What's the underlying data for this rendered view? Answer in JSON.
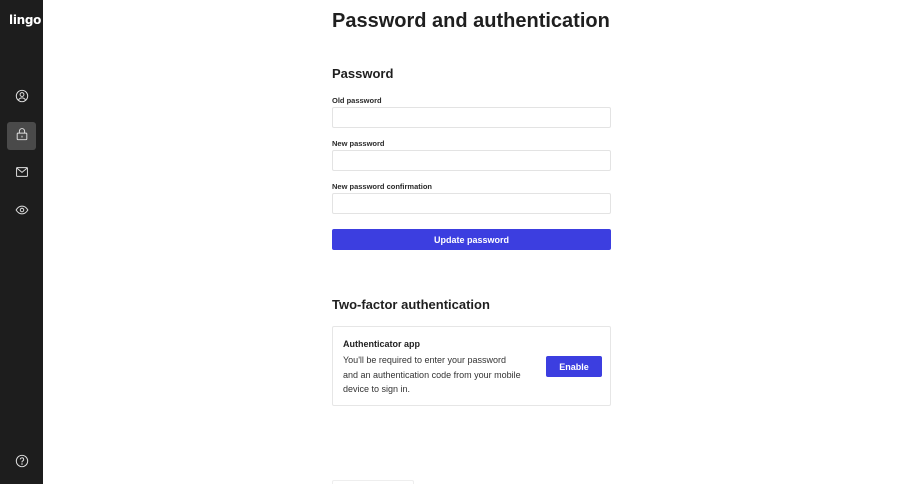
{
  "app": {
    "logo_text": "lingo"
  },
  "sidebar": {
    "items": [
      {
        "icon": "user-circle-icon",
        "active": false
      },
      {
        "icon": "lock-icon",
        "active": true
      },
      {
        "icon": "mail-icon",
        "active": false
      },
      {
        "icon": "eye-icon",
        "active": false
      }
    ],
    "help_icon": "help-circle-icon"
  },
  "page": {
    "title": "Password and authentication"
  },
  "password": {
    "section_title": "Password",
    "old_label": "Old password",
    "old_value": "",
    "new_label": "New password",
    "new_value": "",
    "confirm_label": "New password confirmation",
    "confirm_value": "",
    "submit_label": "Update password"
  },
  "two_factor": {
    "section_title": "Two-factor authentication",
    "app_title": "Authenticator app",
    "app_description": "You'll be required to enter your password and an authentication code from your mobile device to sign in.",
    "enable_label": "Enable"
  },
  "colors": {
    "sidebar_bg": "#1d1d1d",
    "sidebar_active": "#4a4a4a",
    "accent": "#3c3ee0"
  }
}
